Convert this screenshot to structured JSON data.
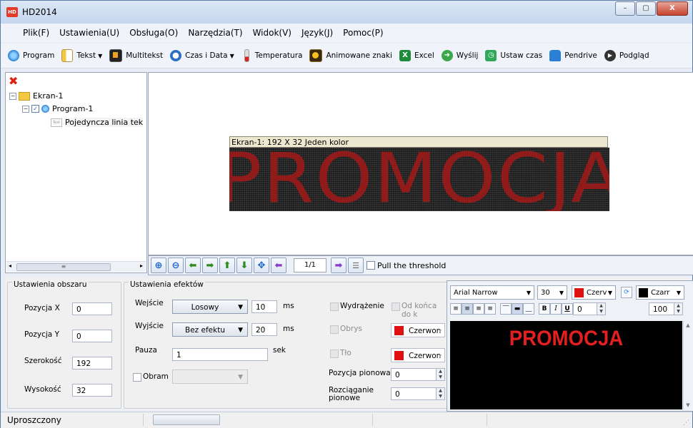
{
  "window": {
    "title": "HD2014",
    "app_icon_text": "HD",
    "minimize": "–",
    "maximize": "▢",
    "close": "X"
  },
  "menu": [
    "Plik(F)",
    "Ustawienia(U)",
    "Obsługa(O)",
    "Narzędzia(T)",
    "Widok(V)",
    "Język(J)",
    "Pomoc(P)"
  ],
  "toolbar": {
    "program": "Program",
    "tekst": "Tekst",
    "multitekst": "Multitekst",
    "czas_data": "Czas i Data",
    "temperatura": "Temperatura",
    "animowane": "Animowane znaki",
    "excel": "Excel",
    "wyslij": "Wyślij",
    "ustaw_czas": "Ustaw czas",
    "pendrive": "Pendrive",
    "podglad": "Podgląd"
  },
  "tree": {
    "screen": "Ekran-1",
    "program": "Program-1",
    "item": "Pojedyncza linia tek",
    "item_icon_text": "Text"
  },
  "canvas": {
    "caption": "Ekran-1: 192 X 32 Jeden kolor",
    "led_text": "PROMOCJA",
    "page": "1/1",
    "threshold_label": "Pull the threshold"
  },
  "area": {
    "title": "Ustawienia obszaru",
    "pos_x_label": "Pozycja X",
    "pos_x": "0",
    "pos_y_label": "Pozycja Y",
    "pos_y": "0",
    "width_label": "Szerokość",
    "width": "192",
    "height_label": "Wysokość",
    "height": "32"
  },
  "effects": {
    "title": "Ustawienia efektów",
    "entry_label": "Wejście",
    "entry_value": "Losowy",
    "entry_speed": "10",
    "entry_unit": "ms",
    "exit_label": "Wyjście",
    "exit_value": "Bez efektu",
    "exit_speed": "20",
    "exit_unit": "ms",
    "pause_label": "Pauza",
    "pause_value": "1",
    "pause_unit": "sek",
    "frame_label": "Obram",
    "emboss_label": "Wydrążenie",
    "from_end_label": "Od końca do k",
    "outline_label": "Obrys",
    "outline_color": "Czerwon",
    "bg_label": "Tło",
    "bg_color": "Czerwon",
    "vpos_label": "Pozycja pionowa",
    "vpos_value": "0",
    "vstretch_label": "Rozciąganie pionowe",
    "vstretch_value": "0"
  },
  "editor": {
    "font": "Arial Narrow",
    "size": "30",
    "fg_color": "Czerv",
    "bg_color": "Czarr",
    "spacing": "0",
    "zoom": "100",
    "text": "PROMOCJA",
    "bold": "B",
    "italic": "I",
    "underline": "U"
  },
  "status": {
    "mode": "Uproszczony"
  },
  "colors": {
    "accent_red": "#e01010",
    "led_red": "#9c1a1a",
    "led_bg": "#1a1a1a"
  }
}
